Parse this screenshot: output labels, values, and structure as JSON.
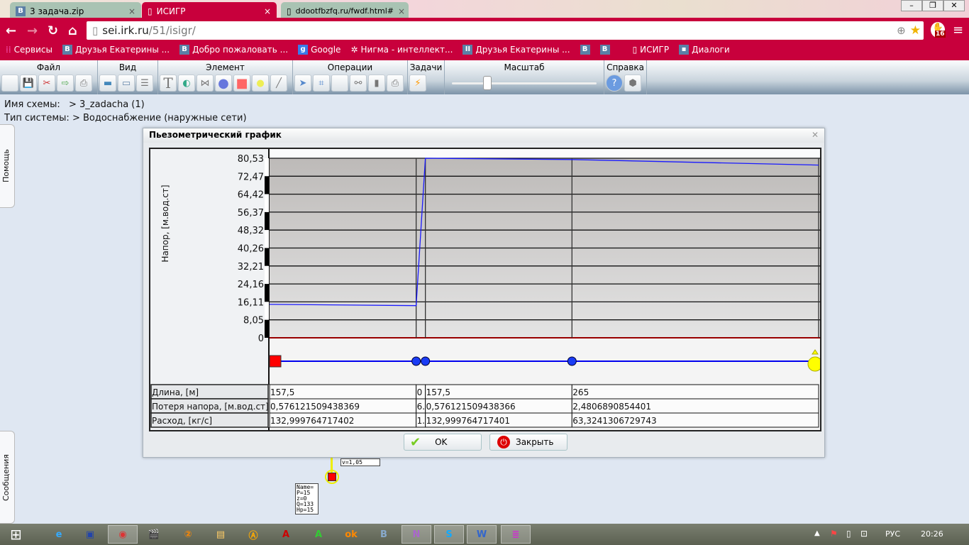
{
  "browser": {
    "tabs": [
      {
        "label": "3 задача.zip",
        "active": false
      },
      {
        "label": "ИСИГР",
        "active": true
      },
      {
        "label": "ddootfbzfq.ru/fwdf.html#",
        "active": false
      }
    ],
    "url_host": "sei.irk.ru",
    "url_path": "/51/isigr/",
    "ext_badge": "16",
    "bookmarks": [
      "Сервисы",
      "Друзья Екатерины ...",
      "Добро пожаловать ...",
      "Google",
      "Нигма - интеллект...",
      "Друзья Екатерины ...",
      "",
      "",
      "ИСИГР",
      "Диалоги"
    ]
  },
  "toolbar": {
    "groups": [
      {
        "label": "Файл"
      },
      {
        "label": "Вид"
      },
      {
        "label": "Элемент"
      },
      {
        "label": "Операции"
      },
      {
        "label": "Задачи"
      },
      {
        "label": "Масштаб"
      },
      {
        "label": "Справка"
      }
    ],
    "zoom_level": 0.23
  },
  "info": {
    "scheme_label": "Имя схемы:",
    "scheme_value": "> 3_zadacha (1)",
    "system_label": "Тип системы:",
    "system_value": "> Водоснабжение (наружные сети)"
  },
  "side": {
    "help": "Помощь",
    "messages": "Сообщения"
  },
  "dialog": {
    "title": "Пьезометрический график",
    "ok": "OK",
    "close": "Закрыть"
  },
  "chart_data": {
    "type": "line",
    "title": "Пьезометрический график",
    "ylabel": "Напор, [м.вод.ст]",
    "ylim": [
      0,
      80.53
    ],
    "yticks": [
      "80,53",
      "72,47",
      "64,42",
      "56,37",
      "48,32",
      "40,26",
      "32,21",
      "24,16",
      "16,11",
      "8,05",
      "0"
    ],
    "segment_lengths": [
      157.5,
      0,
      157.5,
      265
    ],
    "head": [
      15.0,
      14.42,
      80.53,
      79.95,
      77.47
    ],
    "nodes": [
      "source",
      "junction",
      "junction",
      "junction",
      "consumer"
    ],
    "series_color": "#1a1aff"
  },
  "table": {
    "headers": [
      "Длина, [м]",
      "Потеря напора, [м.вод.ст]",
      "Расход, [кг/с]"
    ],
    "rows": [
      [
        "157,5",
        "0",
        "157,5",
        "265"
      ],
      [
        "0,576121509438369",
        "6.",
        "0,576121509438366",
        "2,4806890854401"
      ],
      [
        "132,999764717402",
        "1.",
        "132,999764717401",
        "63,3241306729743"
      ]
    ]
  },
  "canvas": {
    "node_label": [
      "Name=",
      "P=15",
      "z=0",
      "Q=133",
      "Hp=15"
    ],
    "partial_label": "v=1,05"
  },
  "taskbar": {
    "lang": "РУС",
    "time": "20:26"
  }
}
